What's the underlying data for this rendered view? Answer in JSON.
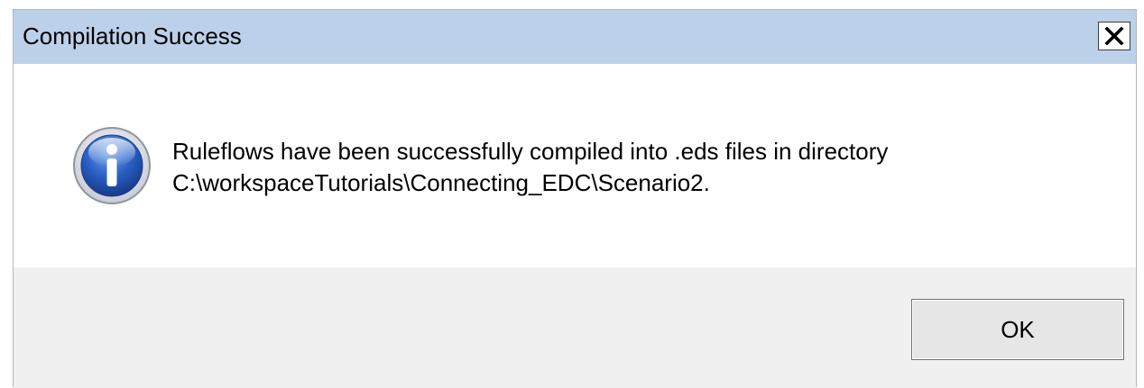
{
  "dialog": {
    "title": "Compilation Success",
    "close_label": "Close",
    "message_lines": [
      "Ruleflows have been successfully compiled into .eds files in directory",
      "C:\\workspaceTutorials\\Connecting_EDC\\Scenario2."
    ],
    "icon": "information-icon",
    "ok_label": "OK"
  },
  "colors": {
    "titlebar": "#bdd0e9",
    "content_bg": "#ffffff",
    "footer_bg": "#f0f0f0",
    "icon_blue": "#2a5fc4"
  }
}
